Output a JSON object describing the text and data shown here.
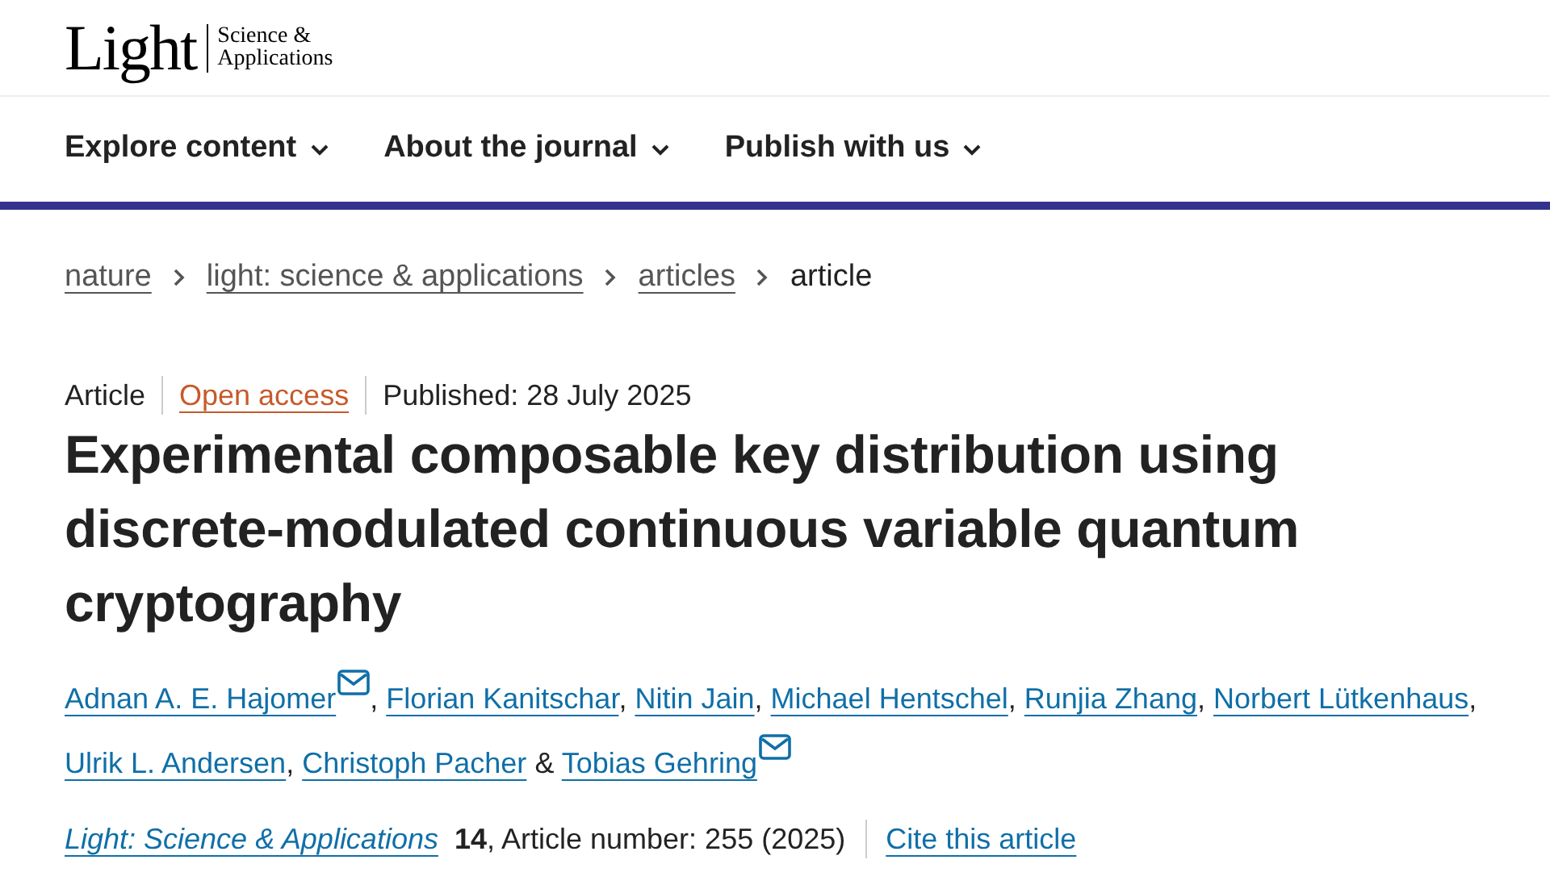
{
  "logo": {
    "main": "Light",
    "sub_1": "Science &",
    "sub_2": "Applications"
  },
  "nav": [
    {
      "label": "Explore content"
    },
    {
      "label": "About the journal"
    },
    {
      "label": "Publish with us"
    }
  ],
  "breadcrumbs": [
    {
      "label": "nature",
      "kind": "link"
    },
    {
      "label": "light: science & applications",
      "kind": "link"
    },
    {
      "label": "articles",
      "kind": "link"
    },
    {
      "label": "article",
      "kind": "current"
    }
  ],
  "meta": {
    "type": "Article",
    "access": "Open access",
    "published": "Published: 28 July 2025"
  },
  "title": "Experimental composable key distribution using discrete-modulated continuous variable quantum cryptography",
  "authors": [
    {
      "name": "Adnan A. E. Hajomer",
      "corresponding": true,
      "separator": ","
    },
    {
      "name": "Florian Kanitschar",
      "corresponding": false,
      "separator": ","
    },
    {
      "name": "Nitin Jain",
      "corresponding": false,
      "separator": ","
    },
    {
      "name": "Michael Hentschel",
      "corresponding": false,
      "separator": ","
    },
    {
      "name": "Runjia Zhang",
      "corresponding": false,
      "separator": ","
    },
    {
      "name": "Norbert Lütkenhaus",
      "corresponding": false,
      "separator": ","
    },
    {
      "name": "Ulrik L. Andersen",
      "corresponding": false,
      "separator": ","
    },
    {
      "name": "Christoph Pacher",
      "corresponding": false,
      "separator": "&"
    },
    {
      "name": "Tobias Gehring",
      "corresponding": true
    }
  ],
  "citation": {
    "journal": "Light: Science & Applications",
    "volume": "14",
    "details": ", Article number: 255 (2025)",
    "cite": "Cite this article"
  }
}
